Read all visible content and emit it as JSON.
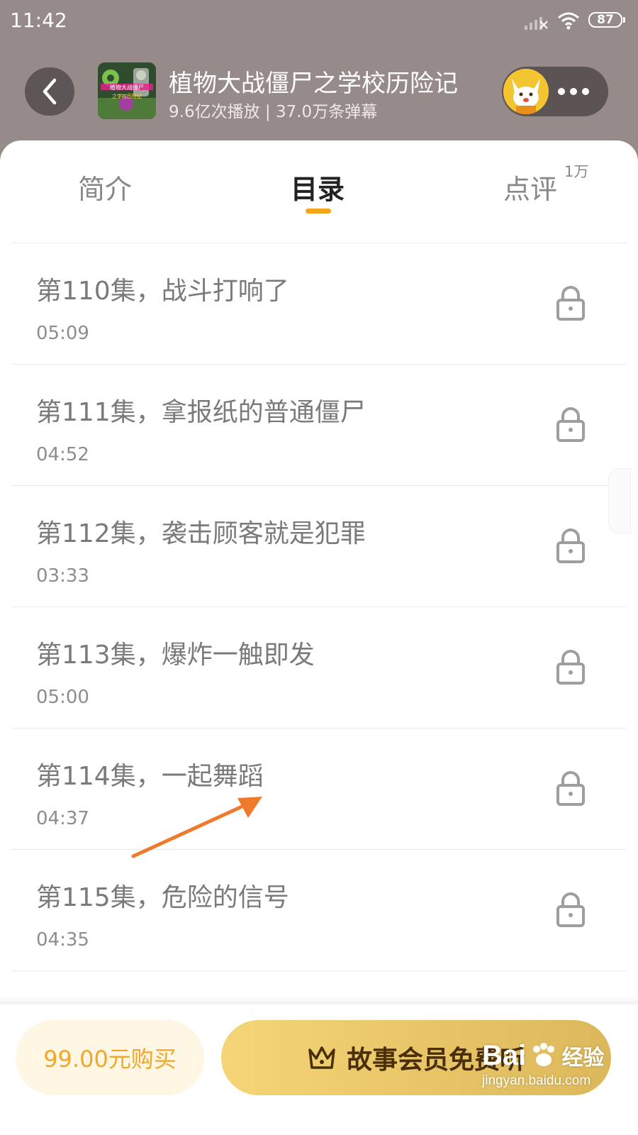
{
  "status_bar": {
    "time": "11:42",
    "battery": "87",
    "signal_icon": "signal-icon",
    "wifi_icon": "wifi-icon"
  },
  "header": {
    "back_icon": "chevron-left-icon",
    "cover_text_line1": "植物大战僵尸",
    "cover_text_line2": "之学校历险记",
    "title": "植物大战僵尸之学校历险记",
    "subtitle": "9.6亿次播放 | 37.0万条弹幕",
    "more_icon": "more-dots-icon"
  },
  "tabs": [
    {
      "label": "简介"
    },
    {
      "label": "目录",
      "active": true
    },
    {
      "label": "点评",
      "badge": "1万"
    }
  ],
  "episodes": [
    {
      "title": "第110集，战斗打响了",
      "duration": "05:09",
      "locked": true
    },
    {
      "title": "第111集，拿报纸的普通僵尸",
      "duration": "04:52",
      "locked": true
    },
    {
      "title": "第112集，袭击顾客就是犯罪",
      "duration": "03:33",
      "locked": true
    },
    {
      "title": "第113集，爆炸一触即发",
      "duration": "05:00",
      "locked": true
    },
    {
      "title": "第114集，一起舞蹈",
      "duration": "04:37",
      "locked": true
    },
    {
      "title": "第115集，危险的信号",
      "duration": "04:35",
      "locked": true
    }
  ],
  "bottom_bar": {
    "buy_label": "99.00元购买",
    "member_label": "故事会员免费听",
    "member_icon": "crown-icon"
  },
  "watermark": {
    "brand": "Bai",
    "brand_suffix": "经验",
    "url": "jingyan.baidu.com"
  },
  "colors": {
    "header_bg": "#978b8a",
    "accent": "#f5a41a",
    "annotation_arrow": "#f07a2c",
    "member_gold": "#e9c96a"
  }
}
